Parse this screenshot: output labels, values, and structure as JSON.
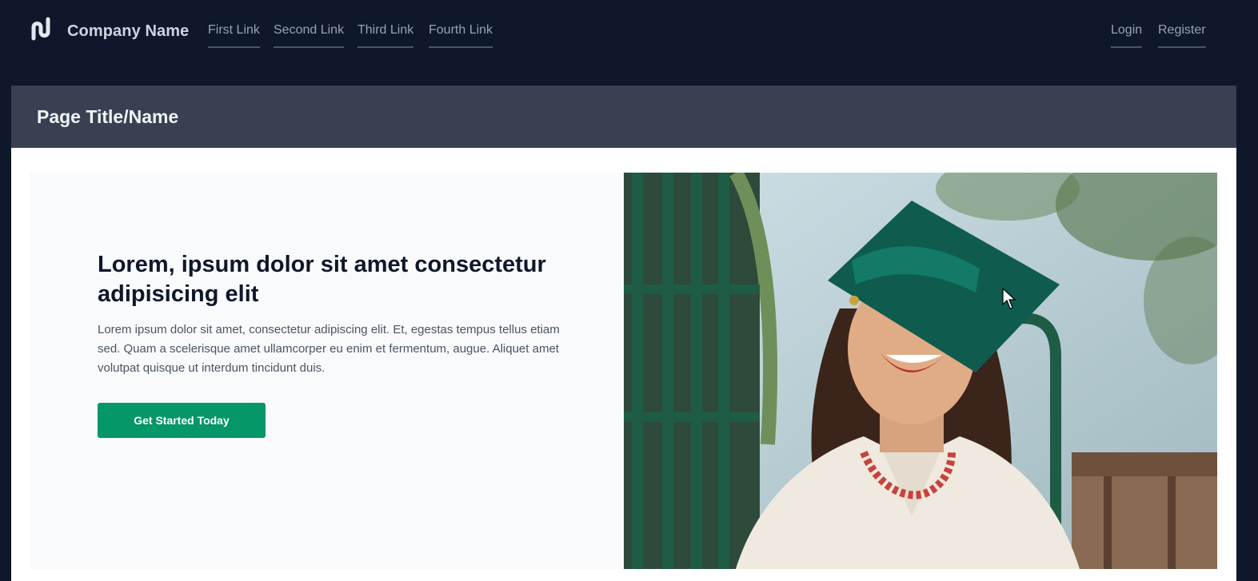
{
  "navbar": {
    "brand": "Company Name",
    "links": [
      "First Link",
      "Second Link",
      "Third Link",
      "Fourth Link"
    ],
    "auth": {
      "login": "Login",
      "register": "Register"
    }
  },
  "page": {
    "title": "Page Title/Name"
  },
  "hero": {
    "heading": "Lorem, ipsum dolor sit amet consectetur adipisicing elit",
    "text": "Lorem ipsum dolor sit amet, consectetur adipiscing elit. Et, egestas tempus tellus etiam sed. Quam a scelerisque amet ullamcorper eu enim et fermentum, augue. Aliquet amet volutpat quisque ut interdum tincidunt duis.",
    "cta": "Get Started Today",
    "image_icon": "graduate-photo"
  },
  "colors": {
    "nav_bg": "#0f172a",
    "title_bar_bg": "#374151",
    "accent": "#059669",
    "hero_panel_bg": "#f8fafc"
  }
}
